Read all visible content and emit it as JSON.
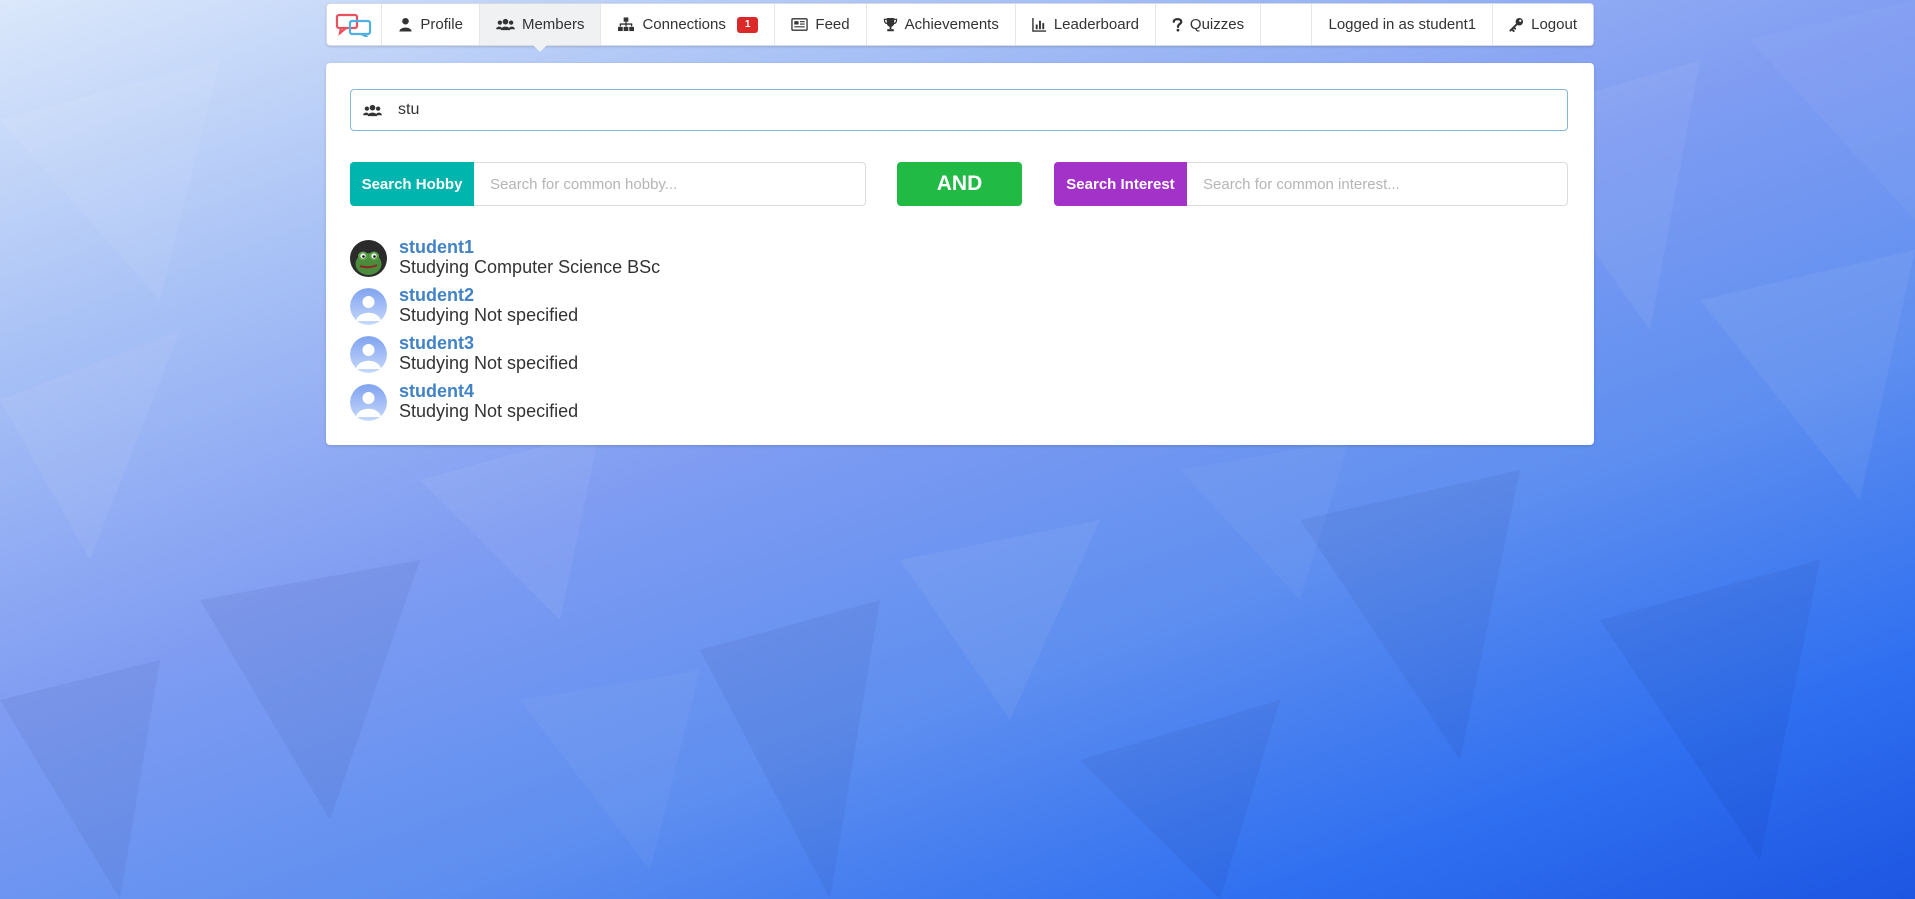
{
  "nav": {
    "items": [
      {
        "label": "Profile",
        "icon": "user-icon"
      },
      {
        "label": "Members",
        "icon": "users-icon",
        "active": true
      },
      {
        "label": "Connections",
        "icon": "sitemap-icon",
        "badge": "1"
      },
      {
        "label": "Feed",
        "icon": "newspaper-icon"
      },
      {
        "label": "Achievements",
        "icon": "trophy-icon"
      },
      {
        "label": "Leaderboard",
        "icon": "bar-chart-icon"
      },
      {
        "label": "Quizzes",
        "icon": "question-icon"
      }
    ],
    "logged_in_text": "Logged in as student1",
    "logout_label": "Logout"
  },
  "search": {
    "value": "stu"
  },
  "filters": {
    "hobby_label": "Search Hobby",
    "hobby_placeholder": "Search for common hobby...",
    "and_label": "AND",
    "interest_label": "Search Interest",
    "interest_placeholder": "Search for common interest..."
  },
  "members": [
    {
      "name": "student1",
      "description": "Studying Computer Science BSc",
      "avatar": "frog-avatar"
    },
    {
      "name": "student2",
      "description": "Studying Not specified",
      "avatar": "default-avatar"
    },
    {
      "name": "student3",
      "description": "Studying Not specified",
      "avatar": "default-avatar"
    },
    {
      "name": "student4",
      "description": "Studying Not specified",
      "avatar": "default-avatar"
    }
  ],
  "colors": {
    "hobby": "#00b5ad",
    "and": "#21ba45",
    "interest": "#a333c8",
    "link": "#4183c4",
    "badge": "#db2828"
  }
}
